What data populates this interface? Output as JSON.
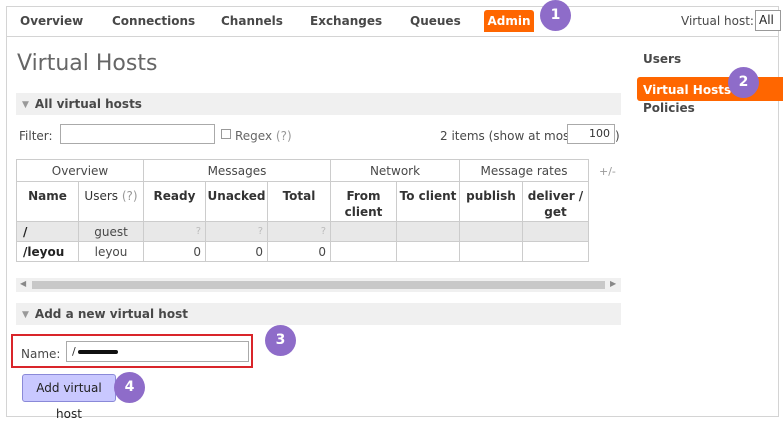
{
  "nav": {
    "tabs": [
      "Overview",
      "Connections",
      "Channels",
      "Exchanges",
      "Queues"
    ],
    "active_tab": "Admin",
    "virtual_host_label": "Virtual host:",
    "virtual_host_value": "All"
  },
  "page_title": "Virtual Hosts",
  "all_vhosts": {
    "header": "All virtual hosts",
    "filter_label": "Filter:",
    "regex_label": "Regex",
    "regex_help": "(?)",
    "items_text": "2 items (show at most",
    "items_value": "100",
    "items_close": ")",
    "plus_minus": "+/-",
    "groups": [
      "Overview",
      "Messages",
      "Network",
      "Message rates"
    ],
    "columns": [
      "Name",
      "Users",
      "Ready",
      "Unacked",
      "Total",
      "From client",
      "To client",
      "publish",
      "deliver / get"
    ],
    "users_help": "(?)",
    "rows": [
      {
        "name": "/",
        "users": "guest",
        "ready": "?",
        "unacked": "?",
        "total": "?"
      },
      {
        "name": "/leyou",
        "users": "leyou",
        "ready": "0",
        "unacked": "0",
        "total": "0"
      }
    ]
  },
  "add_vhost": {
    "header": "Add a new virtual host",
    "name_label": "Name:",
    "name_value": "/",
    "button_label": "Add virtual host"
  },
  "sidebar": {
    "items": [
      "Users",
      "Virtual Hosts",
      "Policies"
    ],
    "active": "Virtual Hosts"
  },
  "callouts": [
    "1",
    "2",
    "3",
    "4"
  ],
  "colors": {
    "accent": "#ff6600",
    "button": "#c9c8ff",
    "callout": "#8e6cc9",
    "highlight_box": "#d9252a"
  }
}
